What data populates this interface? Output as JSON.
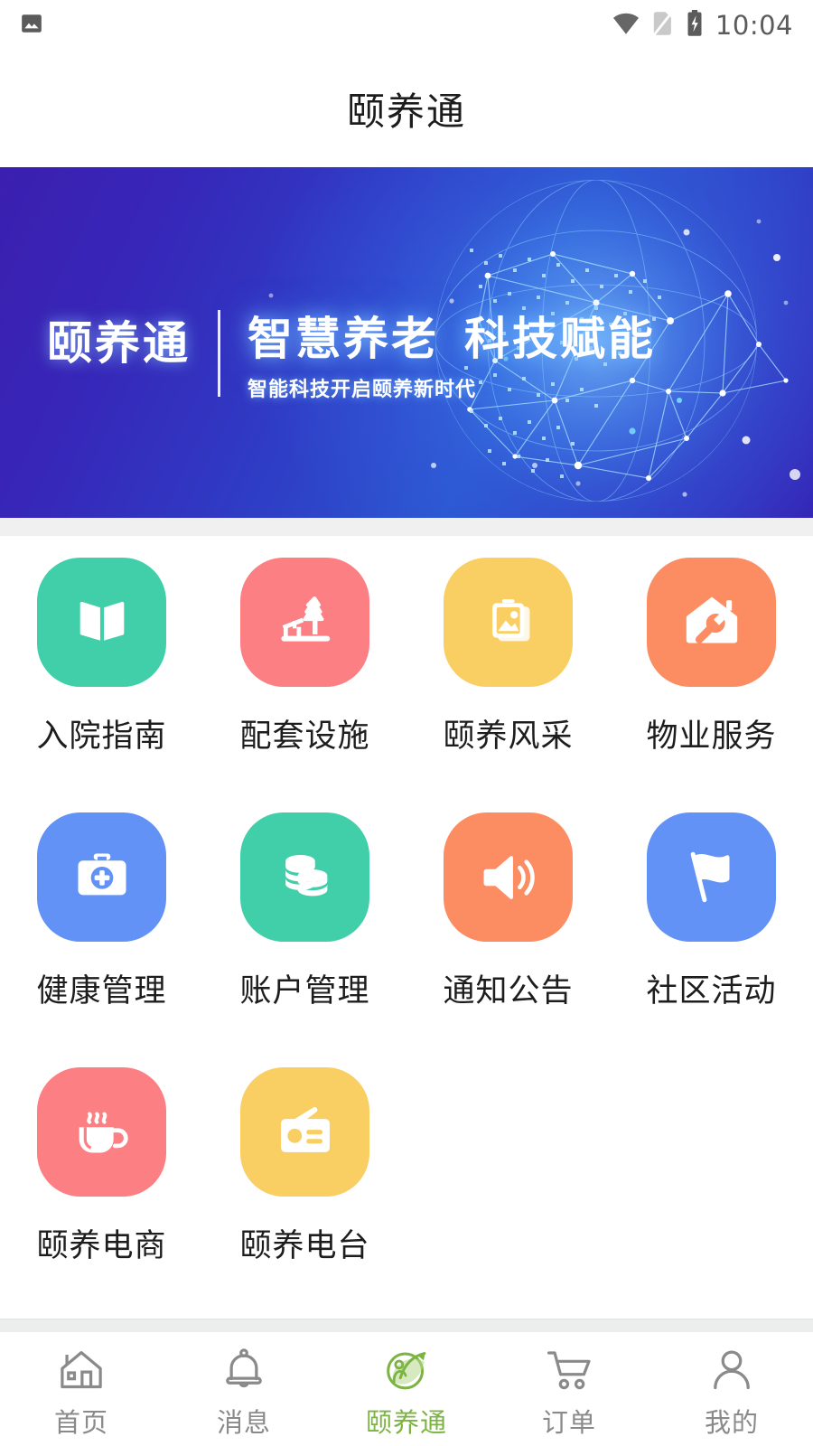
{
  "status_bar": {
    "time": "10:04",
    "icons": [
      "image-notification-icon",
      "wifi-icon",
      "sim-card-off-icon",
      "battery-charging-icon"
    ]
  },
  "header": {
    "title": "颐养通"
  },
  "banner": {
    "logo": "颐养通",
    "headline_left": "智慧养老",
    "headline_right": "科技赋能",
    "subtitle": "智能科技开启颐养新时代",
    "graphic": "network-globe-graphic",
    "bg_color_start": "#3b1fb0",
    "bg_color_end": "#2a55cf"
  },
  "grid": {
    "items": [
      {
        "label": "入院指南",
        "icon": "open-book-icon",
        "color": "#41cfa9"
      },
      {
        "label": "配套设施",
        "icon": "park-tree-icon",
        "color": "#fb7f83"
      },
      {
        "label": "颐养风采",
        "icon": "photo-stack-icon",
        "color": "#f9cf64"
      },
      {
        "label": "物业服务",
        "icon": "house-wrench-icon",
        "color": "#fc8d62"
      },
      {
        "label": "健康管理",
        "icon": "medical-kit-icon",
        "color": "#6292f5"
      },
      {
        "label": "账户管理",
        "icon": "coin-stack-icon",
        "color": "#41cfa9"
      },
      {
        "label": "通知公告",
        "icon": "speaker-icon",
        "color": "#fc8d62"
      },
      {
        "label": "社区活动",
        "icon": "flag-icon",
        "color": "#6292f5"
      },
      {
        "label": "颐养电商",
        "icon": "coffee-cup-icon",
        "color": "#fb7f83"
      },
      {
        "label": "颐养电台",
        "icon": "radio-icon",
        "color": "#f9cf64"
      }
    ]
  },
  "tabbar": {
    "active_color": "#7cb342",
    "inactive_color": "#8a8a8a",
    "items": [
      {
        "label": "首页",
        "icon": "home-icon",
        "active": false
      },
      {
        "label": "消息",
        "icon": "bell-icon",
        "active": false
      },
      {
        "label": "颐养通",
        "icon": "leaf-person-icon",
        "active": true
      },
      {
        "label": "订单",
        "icon": "cart-icon",
        "active": false
      },
      {
        "label": "我的",
        "icon": "person-icon",
        "active": false
      }
    ]
  }
}
